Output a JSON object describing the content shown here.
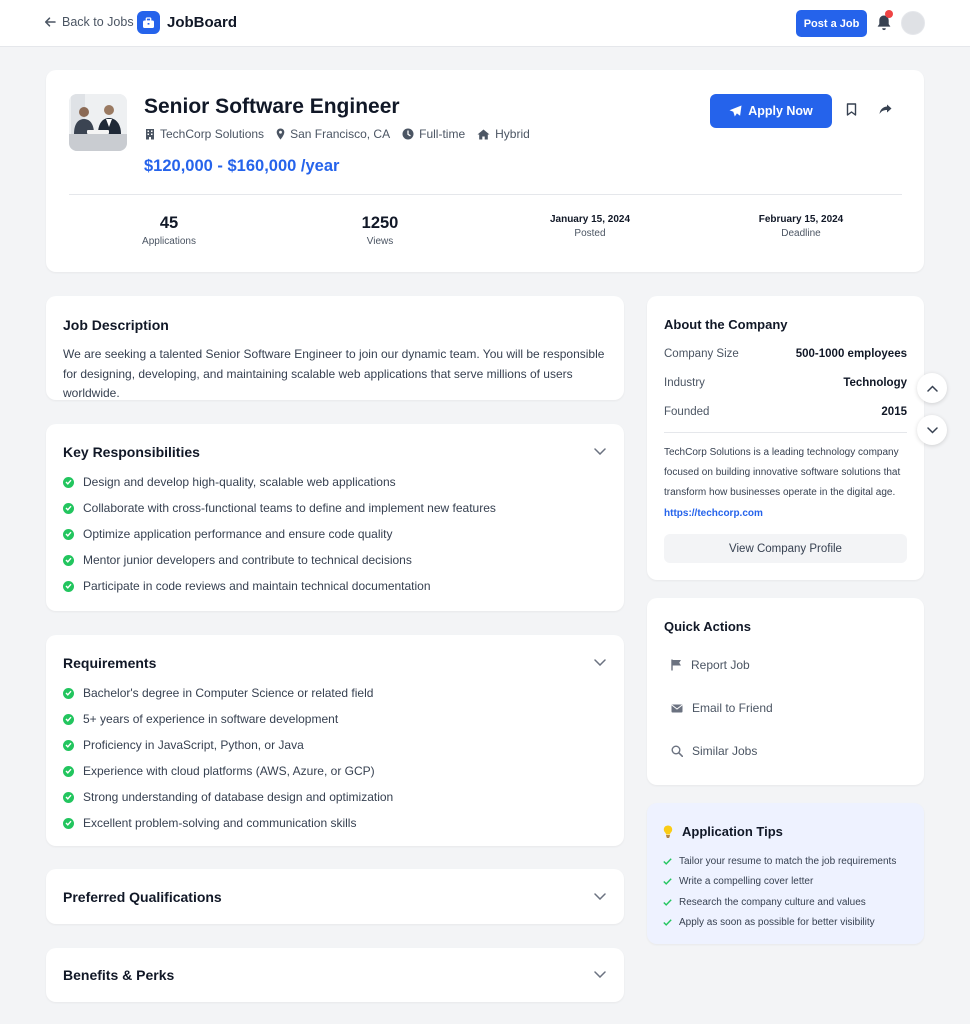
{
  "nav": {
    "back_label": "Back to Jobs",
    "brand": "JobBoard",
    "post_label": "Post a Job"
  },
  "job": {
    "title": "Senior Software Engineer",
    "company": "TechCorp Solutions",
    "location": "San Francisco, CA",
    "type": "Full-time",
    "work_mode": "Hybrid",
    "salary": "$120,000 - $160,000 /year",
    "apply_label": "Apply Now"
  },
  "stats": [
    {
      "value": "45",
      "label": "Applications"
    },
    {
      "value": "1250",
      "label": "Views"
    },
    {
      "value": "January 15, 2024",
      "label": "Posted"
    },
    {
      "value": "February 15, 2024",
      "label": "Deadline"
    }
  ],
  "description": {
    "title": "Job Description",
    "text": "We are seeking a talented Senior Software Engineer to join our dynamic team. You will be responsible for designing, developing, and maintaining scalable web applications that serve millions of users worldwide."
  },
  "responsibilities": {
    "title": "Key Responsibilities",
    "items": [
      "Design and develop high-quality, scalable web applications",
      "Collaborate with cross-functional teams to define and implement new features",
      "Optimize application performance and ensure code quality",
      "Mentor junior developers and contribute to technical decisions",
      "Participate in code reviews and maintain technical documentation"
    ]
  },
  "requirements": {
    "title": "Requirements",
    "items": [
      "Bachelor's degree in Computer Science or related field",
      "5+ years of experience in software development",
      "Proficiency in JavaScript, Python, or Java",
      "Experience with cloud platforms (AWS, Azure, or GCP)",
      "Strong understanding of database design and optimization",
      "Excellent problem-solving and communication skills"
    ]
  },
  "preferred": {
    "title": "Preferred Qualifications"
  },
  "benefits": {
    "title": "Benefits & Perks"
  },
  "company": {
    "title": "About the Company",
    "rows": [
      {
        "key": "Company Size",
        "value": "500-1000 employees"
      },
      {
        "key": "Industry",
        "value": "Technology"
      },
      {
        "key": "Founded",
        "value": "2015"
      }
    ],
    "about": "TechCorp Solutions is a leading technology company focused on building innovative software solutions that transform how businesses operate in the digital age.",
    "url": "https://techcorp.com",
    "profile_label": "View Company Profile"
  },
  "quick_actions": {
    "title": "Quick Actions",
    "items": [
      {
        "label": "Report Job",
        "icon": "flag-icon"
      },
      {
        "label": "Email to Friend",
        "icon": "envelope-icon"
      },
      {
        "label": "Similar Jobs",
        "icon": "search-icon"
      }
    ]
  },
  "tips": {
    "title": "Application Tips",
    "items": [
      "Tailor your resume to match the job requirements",
      "Write a compelling cover letter",
      "Research the company culture and values",
      "Apply as soon as possible for better visibility"
    ]
  },
  "colors": {
    "accent": "#2563eb",
    "success": "#22c55e",
    "notification": "#ef4444",
    "tips_bg": "#eef2ff"
  }
}
